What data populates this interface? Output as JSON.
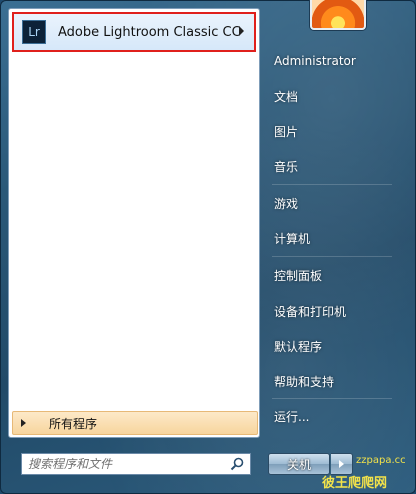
{
  "pinned_program": {
    "icon_text": "Lr",
    "label": "Adobe Lightroom Classic CC",
    "highlight_color": "#e0201c"
  },
  "all_programs_label": "所有程序",
  "search": {
    "placeholder": "搜索程序和文件"
  },
  "right_items": [
    {
      "label": "Administrator"
    },
    {
      "label": "文档"
    },
    {
      "label": "图片"
    },
    {
      "label": "音乐"
    },
    {
      "label": "游戏"
    },
    {
      "label": "计算机"
    },
    {
      "label": "控制面板"
    },
    {
      "label": "设备和打印机"
    },
    {
      "label": "默认程序"
    },
    {
      "label": "帮助和支持"
    },
    {
      "label": "运行..."
    }
  ],
  "shutdown_label": "关机",
  "watermark": {
    "url": "zzpapa.cc",
    "text": "彼王爬爬网"
  }
}
